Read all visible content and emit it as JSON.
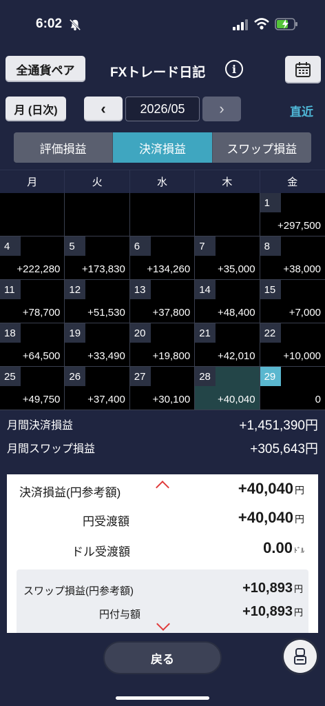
{
  "status": {
    "time": "6:02"
  },
  "header": {
    "pair_button": "全通貨ペア",
    "title": "FXトレード日記",
    "info_label": "i"
  },
  "nav": {
    "mode_button": "月 (日次)",
    "prev": "‹",
    "month": "2026/05",
    "next": "›",
    "recent": "直近"
  },
  "tabs": [
    {
      "label": "評価損益",
      "active": false
    },
    {
      "label": "決済損益",
      "active": true
    },
    {
      "label": "スワップ損益",
      "active": false
    }
  ],
  "weekdays": [
    "月",
    "火",
    "水",
    "木",
    "金"
  ],
  "days": [
    {
      "day": "",
      "pl": ""
    },
    {
      "day": "",
      "pl": ""
    },
    {
      "day": "",
      "pl": ""
    },
    {
      "day": "",
      "pl": ""
    },
    {
      "day": "1",
      "pl": "+297,500"
    },
    {
      "day": "4",
      "pl": "+222,280"
    },
    {
      "day": "5",
      "pl": "+173,830"
    },
    {
      "day": "6",
      "pl": "+134,260"
    },
    {
      "day": "7",
      "pl": "+35,000"
    },
    {
      "day": "8",
      "pl": "+38,000"
    },
    {
      "day": "11",
      "pl": "+78,700"
    },
    {
      "day": "12",
      "pl": "+51,530"
    },
    {
      "day": "13",
      "pl": "+37,800"
    },
    {
      "day": "14",
      "pl": "+48,400"
    },
    {
      "day": "15",
      "pl": "+7,000"
    },
    {
      "day": "18",
      "pl": "+64,500"
    },
    {
      "day": "19",
      "pl": "+33,490"
    },
    {
      "day": "20",
      "pl": "+19,800"
    },
    {
      "day": "21",
      "pl": "+42,010"
    },
    {
      "day": "22",
      "pl": "+10,000"
    },
    {
      "day": "25",
      "pl": "+49,750"
    },
    {
      "day": "26",
      "pl": "+37,400"
    },
    {
      "day": "27",
      "pl": "+30,100"
    },
    {
      "day": "28",
      "pl": "+40,040",
      "selected": true
    },
    {
      "day": "29",
      "pl": "0",
      "today": true
    }
  ],
  "summary": {
    "monthly_settle_label": "月間決済損益",
    "monthly_settle_value": "+1,451,390円",
    "monthly_swap_label": "月間スワップ損益",
    "monthly_swap_value": "+305,643円"
  },
  "detail": {
    "settle_label": "決済損益(円参考額)",
    "settle_value": "+40,040",
    "settle_unit": "円",
    "yen_label": "円受渡額",
    "yen_value": "+40,040",
    "yen_unit": "円",
    "dollar_label": "ドル受渡額",
    "dollar_value": "0.00",
    "dollar_unit": "ﾄﾞﾙ",
    "swap_label": "スワップ損益(円参考額)",
    "swap_value": "+10,893",
    "swap_unit": "円",
    "yen_grant_label": "円付与額",
    "yen_grant_value": "+10,893",
    "yen_grant_unit": "円"
  },
  "bottom": {
    "back_button": "戻る"
  },
  "colors": {
    "accent": "#3fa6c0",
    "background": "#1f2540",
    "today": "#5ab7cf",
    "selected": "#234548",
    "caret": "#e03a3a"
  }
}
